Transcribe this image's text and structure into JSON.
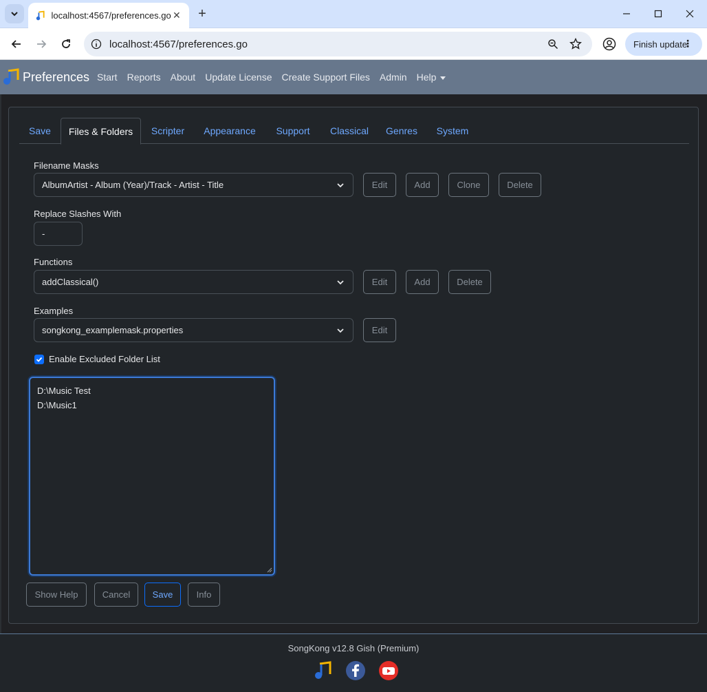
{
  "browser": {
    "tab_title": "localhost:4567/preferences.go",
    "url": "localhost:4567/preferences.go",
    "finish_update_label": "Finish update"
  },
  "navbar": {
    "brand": "Preferences",
    "links": [
      "Start",
      "Reports",
      "About",
      "Update License",
      "Create Support Files",
      "Admin",
      "Help"
    ]
  },
  "tabs": [
    "Save",
    "Files & Folders",
    "Scripter",
    "Appearance",
    "Support",
    "Classical",
    "Genres",
    "System"
  ],
  "active_tab": "Files & Folders",
  "filename_masks": {
    "label": "Filename Masks",
    "selected": "AlbumArtist - Album (Year)/Track - Artist - Title",
    "buttons": [
      "Edit",
      "Add",
      "Clone",
      "Delete"
    ]
  },
  "replace_slashes": {
    "label": "Replace Slashes With",
    "value": "-"
  },
  "functions": {
    "label": "Functions",
    "selected": "addClassical()",
    "buttons": [
      "Edit",
      "Add",
      "Delete"
    ]
  },
  "examples": {
    "label": "Examples",
    "selected": "songkong_examplemask.properties",
    "buttons": [
      "Edit"
    ]
  },
  "excluded": {
    "checkbox_label": "Enable Excluded Folder List",
    "checked": true,
    "folders": [
      "D:\\Music Test",
      "D:\\Music1"
    ]
  },
  "actions": [
    "Show Help",
    "Cancel",
    "Save",
    "Info"
  ],
  "footer": {
    "version": "SongKong v12.8 Gish (Premium)"
  },
  "colors": {
    "navbar": "#67778c",
    "accent": "#0d6efd",
    "link": "#6ea8fe",
    "background": "#212529"
  }
}
